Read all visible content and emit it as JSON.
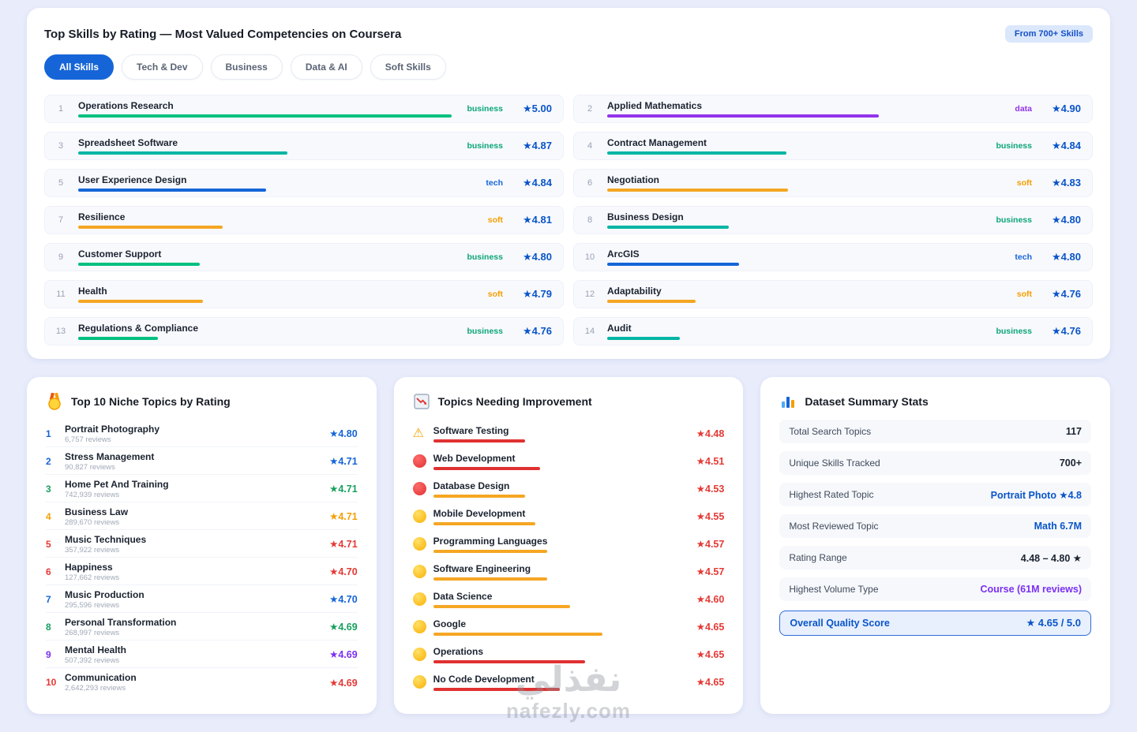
{
  "top_card": {
    "title": "Top Skills by Rating — Most Valued Competencies on Coursera",
    "badge": "From 700+ Skills",
    "tabs": [
      {
        "label": "All Skills",
        "active": true
      },
      {
        "label": "Tech & Dev",
        "active": false
      },
      {
        "label": "Business",
        "active": false
      },
      {
        "label": "Data & AI",
        "active": false
      },
      {
        "label": "Soft Skills",
        "active": false
      }
    ],
    "category_colors": {
      "business": "#0ca678",
      "data": "#9333ea",
      "tech": "#1565d8",
      "soft": "#f59f00"
    },
    "skills": [
      {
        "rank": "1",
        "name": "Operations Research",
        "category": "business",
        "rating": "★5.00",
        "bar_pct": 98,
        "bar_color": "#00c07f"
      },
      {
        "rank": "2",
        "name": "Applied Mathematics",
        "category": "data",
        "rating": "★4.90",
        "bar_pct": 68,
        "bar_color": "#9333ea"
      },
      {
        "rank": "3",
        "name": "Spreadsheet Software",
        "category": "business",
        "rating": "★4.87",
        "bar_pct": 55,
        "bar_color": "#00b5a5"
      },
      {
        "rank": "4",
        "name": "Contract Management",
        "category": "business",
        "rating": "★4.84",
        "bar_pct": 47,
        "bar_color": "#00b5a5"
      },
      {
        "rank": "5",
        "name": "User Experience Design",
        "category": "tech",
        "rating": "★4.84",
        "bar_pct": 47,
        "bar_color": "#1565d8"
      },
      {
        "rank": "6",
        "name": "Negotiation",
        "category": "soft",
        "rating": "★4.83",
        "bar_pct": 45,
        "bar_color": "#f5a623"
      },
      {
        "rank": "7",
        "name": "Resilience",
        "category": "soft",
        "rating": "★4.81",
        "bar_pct": 36,
        "bar_color": "#f5a623"
      },
      {
        "rank": "8",
        "name": "Business Design",
        "category": "business",
        "rating": "★4.80",
        "bar_pct": 32,
        "bar_color": "#00b5a5"
      },
      {
        "rank": "9",
        "name": "Customer Support",
        "category": "business",
        "rating": "★4.80",
        "bar_pct": 32,
        "bar_color": "#00c07f"
      },
      {
        "rank": "10",
        "name": "ArcGIS",
        "category": "tech",
        "rating": "★4.80",
        "bar_pct": 33,
        "bar_color": "#1565d8"
      },
      {
        "rank": "11",
        "name": "Health",
        "category": "soft",
        "rating": "★4.79",
        "bar_pct": 31,
        "bar_color": "#f5a623"
      },
      {
        "rank": "12",
        "name": "Adaptability",
        "category": "soft",
        "rating": "★4.76",
        "bar_pct": 22,
        "bar_color": "#f5a623"
      },
      {
        "rank": "13",
        "name": "Regulations & Compliance",
        "category": "business",
        "rating": "★4.76",
        "bar_pct": 21,
        "bar_color": "#00c07f"
      },
      {
        "rank": "14",
        "name": "Audit",
        "category": "business",
        "rating": "★4.76",
        "bar_pct": 19,
        "bar_color": "#00b5a5"
      }
    ]
  },
  "niche_card": {
    "title": "Top 10 Niche Topics by Rating",
    "icon": "medal-icon",
    "items": [
      {
        "rank": "1",
        "name": "Portrait Photography",
        "reviews": "6,757 reviews",
        "rating": "★4.80",
        "color": "#1565d8"
      },
      {
        "rank": "2",
        "name": "Stress Management",
        "reviews": "90,827 reviews",
        "rating": "★4.71",
        "color": "#1565d8"
      },
      {
        "rank": "3",
        "name": "Home Pet And Training",
        "reviews": "742,939 reviews",
        "rating": "★4.71",
        "color": "#18a05e"
      },
      {
        "rank": "4",
        "name": "Business Law",
        "reviews": "289,670 reviews",
        "rating": "★4.71",
        "color": "#f59f00"
      },
      {
        "rank": "5",
        "name": "Music Techniques",
        "reviews": "357,922 reviews",
        "rating": "★4.71",
        "color": "#e53935"
      },
      {
        "rank": "6",
        "name": "Happiness",
        "reviews": "127,662 reviews",
        "rating": "★4.70",
        "color": "#e53935"
      },
      {
        "rank": "7",
        "name": "Music Production",
        "reviews": "295,596 reviews",
        "rating": "★4.70",
        "color": "#1565d8"
      },
      {
        "rank": "8",
        "name": "Personal Transformation",
        "reviews": "268,997 reviews",
        "rating": "★4.69",
        "color": "#18a05e"
      },
      {
        "rank": "9",
        "name": "Mental Health",
        "reviews": "507,392 reviews",
        "rating": "★4.69",
        "color": "#7b2ff2"
      },
      {
        "rank": "10",
        "name": "Communication",
        "reviews": "2,642,293 reviews",
        "rating": "★4.69",
        "color": "#e53935"
      }
    ]
  },
  "improvement_card": {
    "title": "Topics Needing Improvement",
    "icon": "chart-down-icon",
    "items": [
      {
        "name": "Software Testing",
        "rating": "★4.48",
        "icon": "warning",
        "bar_color": "#e03131",
        "bar_pct": 37,
        "rating_color": "#e53935"
      },
      {
        "name": "Web Development",
        "rating": "★4.51",
        "icon": "red-dot",
        "bar_color": "#e03131",
        "bar_pct": 43,
        "rating_color": "#e53935"
      },
      {
        "name": "Database Design",
        "rating": "★4.53",
        "icon": "red-dot",
        "bar_color": "#f5a623",
        "bar_pct": 37,
        "rating_color": "#e53935"
      },
      {
        "name": "Mobile Development",
        "rating": "★4.55",
        "icon": "amber-dot",
        "bar_color": "#f5a623",
        "bar_pct": 41,
        "rating_color": "#e53935"
      },
      {
        "name": "Programming Languages",
        "rating": "★4.57",
        "icon": "amber-dot",
        "bar_color": "#f5a623",
        "bar_pct": 46,
        "rating_color": "#e53935"
      },
      {
        "name": "Software Engineering",
        "rating": "★4.57",
        "icon": "amber-dot",
        "bar_color": "#f5a623",
        "bar_pct": 46,
        "rating_color": "#e53935"
      },
      {
        "name": "Data Science",
        "rating": "★4.60",
        "icon": "amber-dot",
        "bar_color": "#f5a623",
        "bar_pct": 55,
        "rating_color": "#e53935"
      },
      {
        "name": "Google",
        "rating": "★4.65",
        "icon": "amber-dot",
        "bar_color": "#f5a623",
        "bar_pct": 68,
        "rating_color": "#e53935"
      },
      {
        "name": "Operations",
        "rating": "★4.65",
        "icon": "amber-dot",
        "bar_color": "#e03131",
        "bar_pct": 61,
        "rating_color": "#e53935"
      },
      {
        "name": "No Code Development",
        "rating": "★4.65",
        "icon": "amber-dot",
        "bar_color": "#e03131",
        "bar_pct": 51,
        "rating_color": "#e53935"
      }
    ]
  },
  "stats_card": {
    "title": "Dataset Summary Stats",
    "icon": "bar-chart-icon",
    "rows": [
      {
        "label": "Total Search Topics",
        "value": "117",
        "value_color": "#1b2430"
      },
      {
        "label": "Unique Skills Tracked",
        "value": "700+",
        "value_color": "#1b2430"
      },
      {
        "label": "Highest Rated Topic",
        "value": "Portrait Photo ★4.8",
        "value_color": "#0a55c9"
      },
      {
        "label": "Most Reviewed Topic",
        "value": "Math 6.7M",
        "value_color": "#0a55c9"
      },
      {
        "label": "Rating Range",
        "value": "4.48 – 4.80 ★",
        "value_color": "#1b2430"
      },
      {
        "label": "Highest Volume Type",
        "value": "Course (61M reviews)",
        "value_color": "#7b2ff2"
      }
    ],
    "highlight": {
      "label": "Overall Quality Score",
      "value": "★ 4.65 / 5.0"
    }
  },
  "watermark": {
    "line1": "نفذلي",
    "line2": "nafezly.com"
  }
}
